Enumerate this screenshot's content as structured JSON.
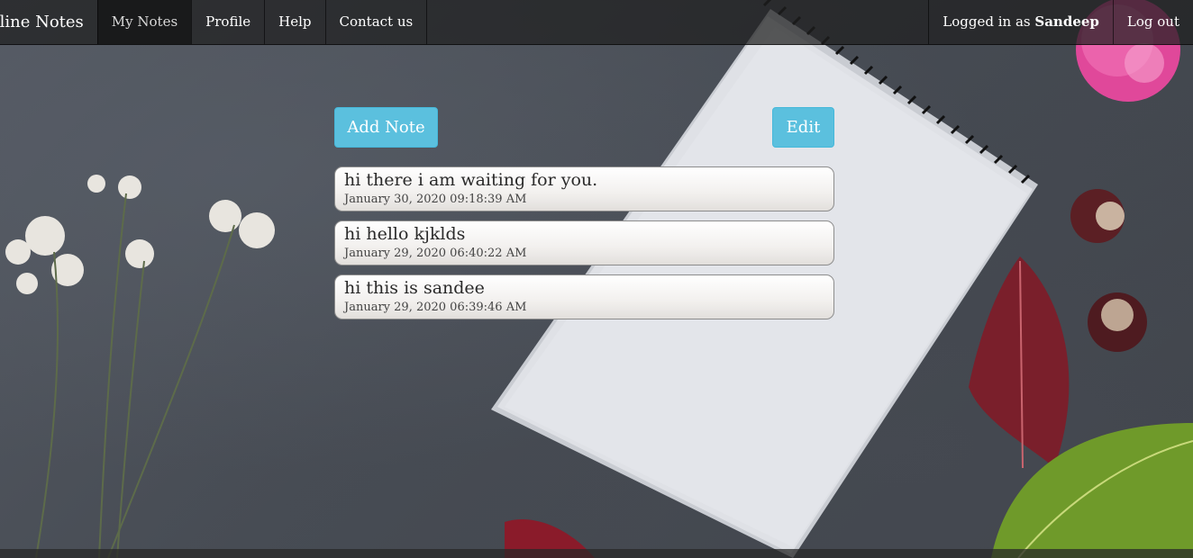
{
  "brand": "nline Notes",
  "nav": {
    "items": [
      {
        "label": "My Notes"
      },
      {
        "label": "Profile"
      },
      {
        "label": "Help"
      },
      {
        "label": "Contact us"
      }
    ],
    "logged_in_prefix": "Logged in as ",
    "username": "Sandeep",
    "logout_label": "Log out"
  },
  "actions": {
    "add_label": "Add Note",
    "edit_label": "Edit"
  },
  "notes": [
    {
      "text": "hi there i am waiting for you.",
      "date": "January 30, 2020 09:18:39 AM"
    },
    {
      "text": "hi hello kjklds",
      "date": "January 29, 2020 06:40:22 AM"
    },
    {
      "text": "hi this is sandee",
      "date": "January 29, 2020 06:39:46 AM"
    }
  ],
  "colors": {
    "accent": "#5bc0de",
    "navbar": "#1e1e1e"
  }
}
